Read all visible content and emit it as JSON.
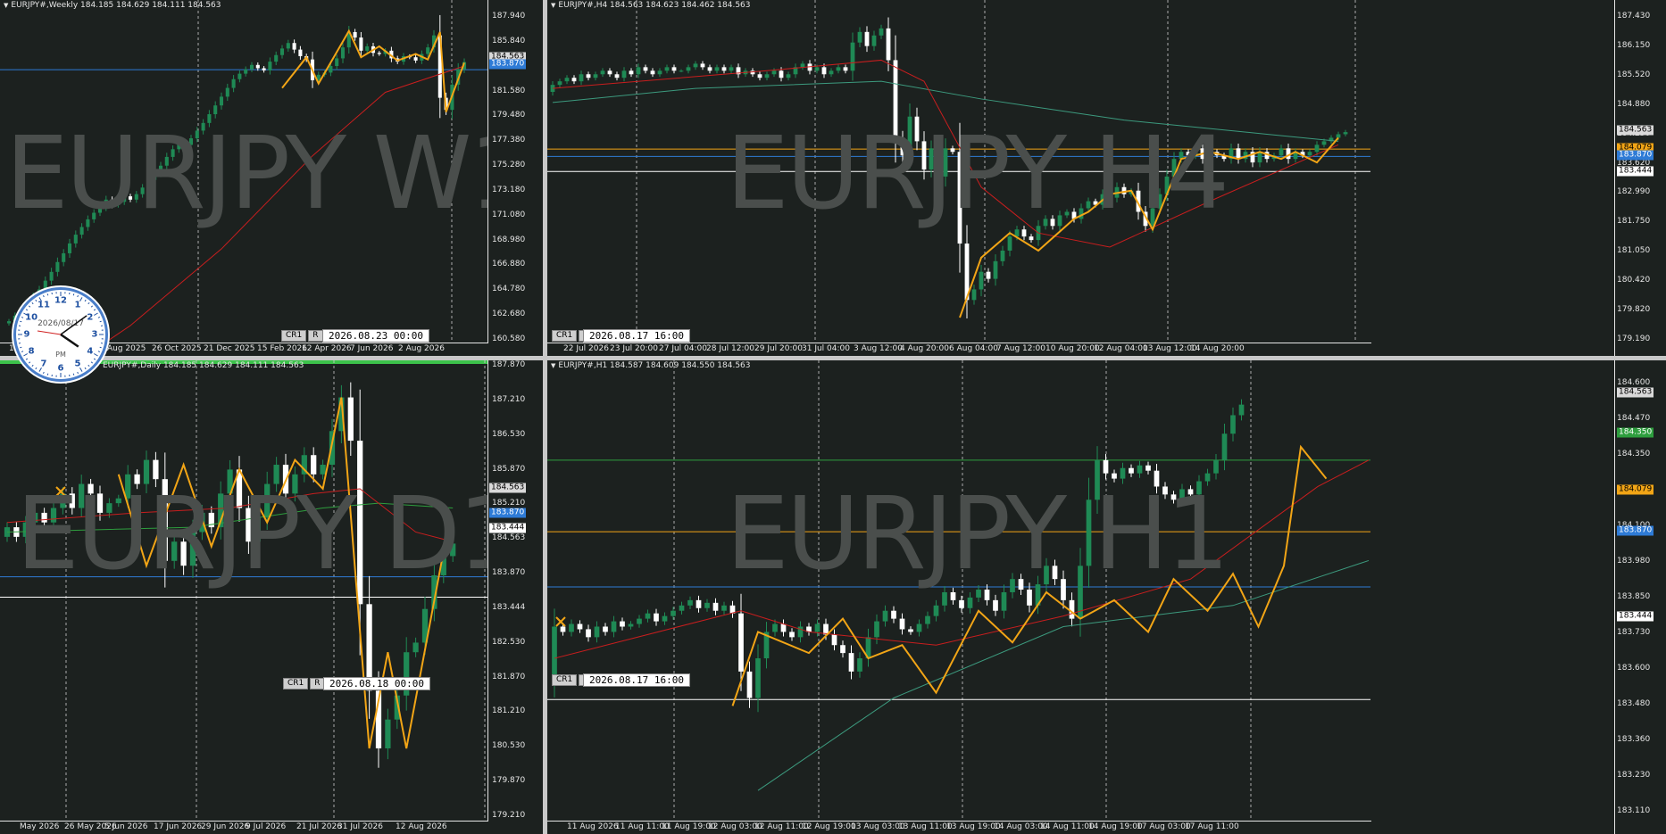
{
  "colors": {
    "bg": "#1c211f",
    "bull": "#1f8a55",
    "bear": "#ffffff",
    "zig": "#f2a516",
    "ma_red": "#c81e1e",
    "ma_teal": "#3c9a7e",
    "hl_blue": "#2e7bd6",
    "hl_orange": "#f2a516",
    "hl_white": "#ffffff",
    "hl_green": "#2e9e3e"
  },
  "panes": [
    {
      "id": "w1",
      "header": "EURJPY#,Weekly  184.185 184.629 184.111 184.563",
      "watermark": "EURJPY W1",
      "yticks": [
        "187.940",
        "185.840",
        "183.870",
        "181.580",
        "179.480",
        "177.380",
        "175.280",
        "173.180",
        "171.080",
        "168.980",
        "166.880",
        "164.780",
        "162.680",
        "160.580"
      ],
      "ytags": [
        {
          "text": "184.563",
          "bg": "#d9d9d9",
          "fg": "#000"
        },
        {
          "text": "183.870",
          "bg": "#2e7bd6",
          "fg": "#fff"
        }
      ],
      "xticks": [
        "1 May",
        "Aug 2025",
        "26 Oct 2025",
        "21 Dec 2025",
        "15 Feb 2026",
        "12 Apr 2026",
        "7 Jun 2026",
        "2 Aug 2026"
      ],
      "ctrl": [
        "CR1",
        "R"
      ],
      "date": "2026.08.23 00:00"
    },
    {
      "id": "h4",
      "header": "EURJPY#,H4  184.563 184.623 184.462 184.563",
      "watermark": "EURJPY H4",
      "yticks": [
        "187.430",
        "186.150",
        "185.520",
        "184.880",
        "184.250",
        "183.620",
        "182.990",
        "181.750",
        "181.050",
        "180.420",
        "179.820",
        "179.190"
      ],
      "ytags": [
        {
          "text": "184.563",
          "bg": "#d9d9d9",
          "fg": "#000"
        },
        {
          "text": "184.079",
          "bg": "#f2a516",
          "fg": "#000"
        },
        {
          "text": "183.870",
          "bg": "#2e7bd6",
          "fg": "#fff"
        },
        {
          "text": "183.444",
          "bg": "#ffffff",
          "fg": "#000"
        }
      ],
      "xticks": [
        "22 Jul 2026",
        "23 Jul 20:00",
        "27 Jul 04:00",
        "28 Jul 12:00",
        "29 Jul 20:00",
        "31 Jul 04:00",
        "3 Aug 12:00",
        "4 Aug 20:00",
        "6 Aug 04:00",
        "7 Aug 12:00",
        "10 Aug 20:00",
        "12 Aug 04:00",
        "13 Aug 12:00",
        "14 Aug 20:00"
      ],
      "ctrl": [
        "CR1",
        "R"
      ],
      "date": "2026.08.17 16:00"
    },
    {
      "id": "d1",
      "header": "EURJPY#,Daily  184.185 184.629 184.111 184.563",
      "watermark": "EURJPY D1",
      "yticks": [
        "187.870",
        "187.210",
        "186.530",
        "185.870",
        "185.210",
        "184.563",
        "183.870",
        "183.444",
        "182.530",
        "181.870",
        "181.210",
        "180.530",
        "179.870",
        "179.210"
      ],
      "ytags": [
        {
          "text": "184.563",
          "bg": "#d9d9d9",
          "fg": "#000"
        },
        {
          "text": "183.870",
          "bg": "#2e7bd6",
          "fg": "#fff"
        },
        {
          "text": "183.444",
          "bg": "#ffffff",
          "fg": "#000"
        }
      ],
      "xticks": [
        "May 2026",
        "26 May 2026",
        "5 Jun 2026",
        "17 Jun 2026",
        "29 Jun 2026",
        "9 Jul 2026",
        "21 Jul 2026",
        "31 Jul 2026",
        "12 Aug 2026"
      ],
      "ctrl": [
        "CR1",
        "R"
      ],
      "date": "2026.08.18 00:00"
    },
    {
      "id": "h1",
      "header": "EURJPY#,H1  184.587 184.609 184.550 184.563",
      "watermark": "EURJPY H1",
      "yticks": [
        "184.600",
        "184.470",
        "184.350",
        "184.230",
        "184.100",
        "183.980",
        "183.850",
        "183.730",
        "183.600",
        "183.480",
        "183.360",
        "183.230",
        "183.110"
      ],
      "ytags": [
        {
          "text": "184.563",
          "bg": "#d9d9d9",
          "fg": "#000"
        },
        {
          "text": "184.350",
          "bg": "#2e9e3e",
          "fg": "#fff"
        },
        {
          "text": "184.079",
          "bg": "#f2a516",
          "fg": "#000"
        },
        {
          "text": "183.870",
          "bg": "#2e7bd6",
          "fg": "#fff"
        },
        {
          "text": "183.444",
          "bg": "#ffffff",
          "fg": "#000"
        }
      ],
      "xticks": [
        "11 Aug 2026",
        "11 Aug 11:00",
        "11 Aug 19:00",
        "12 Aug 03:00",
        "12 Aug 11:00",
        "12 Aug 19:00",
        "13 Aug 03:00",
        "13 Aug 11:00",
        "13 Aug 19:00",
        "14 Aug 03:00",
        "14 Aug 11:00",
        "14 Aug 19:00",
        "17 Aug 03:00",
        "17 Aug 11:00"
      ],
      "ctrl": [
        "CR1",
        "R"
      ],
      "date": "2026.08.17 16:00"
    }
  ],
  "clock": {
    "date": "2026/08/17",
    "ampm": "PM",
    "numbers": [
      "12",
      "1",
      "2",
      "3",
      "4",
      "5",
      "6",
      "7",
      "8",
      "9",
      "10",
      "11"
    ],
    "hour": 4,
    "minute": 9
  },
  "series": {
    "w1": {
      "closes": [
        160.9,
        161.4,
        161.9,
        162.6,
        163.2,
        163.8,
        164.6,
        165.4,
        166.3,
        167.1,
        168.0,
        168.8,
        169.5,
        170.2,
        170.8,
        171.3,
        172.0,
        171.5,
        171.8,
        172.3,
        172.0,
        172.5,
        173.1,
        173.8,
        174.4,
        175.1,
        175.9,
        176.6,
        177.2,
        177.0,
        177.6,
        178.3,
        179.0,
        179.8,
        180.6,
        181.4,
        182.2,
        183.0,
        183.5,
        183.9,
        184.3,
        184.0,
        183.8,
        184.6,
        185.2,
        185.8,
        186.3,
        185.7,
        185.1,
        184.8,
        182.9,
        183.4,
        183.6,
        184.2,
        184.9,
        185.9,
        187.3,
        186.8,
        185.6,
        186.0,
        185.4,
        185.3,
        185.6,
        184.9,
        184.6,
        185.1,
        185.0,
        184.7,
        185.3,
        185.9,
        187.0,
        181.3,
        180.2,
        182.5,
        183.9,
        184.56
      ],
      "zig": [
        [
          45,
          182.2
        ],
        [
          49,
          185.0
        ],
        [
          51,
          182.6
        ],
        [
          56,
          187.4
        ],
        [
          58,
          185.0
        ],
        [
          61,
          186.0
        ],
        [
          64,
          184.7
        ],
        [
          67,
          185.3
        ],
        [
          69,
          184.8
        ],
        [
          71,
          187.3
        ],
        [
          72,
          180.0
        ],
        [
          75,
          184.5
        ]
      ],
      "ma": [
        [
          0,
          153.0
        ],
        [
          20,
          160.5
        ],
        [
          35,
          167.5
        ],
        [
          50,
          176.0
        ],
        [
          62,
          181.8
        ],
        [
          75,
          184.2
        ]
      ]
    },
    "h4": {
      "closes": [
        185.9,
        186.0,
        186.1,
        186.0,
        186.2,
        186.1,
        186.2,
        186.3,
        186.2,
        186.1,
        186.3,
        186.2,
        186.4,
        186.3,
        186.2,
        186.3,
        186.4,
        186.3,
        186.3,
        186.4,
        186.5,
        186.4,
        186.3,
        186.4,
        186.3,
        186.4,
        186.2,
        186.3,
        186.2,
        186.1,
        186.2,
        186.3,
        186.1,
        186.2,
        186.4,
        186.5,
        186.3,
        186.4,
        186.2,
        186.3,
        186.4,
        186.3,
        187.1,
        187.4,
        187.0,
        187.3,
        187.5,
        186.6,
        184.4,
        183.9,
        185.0,
        184.3,
        183.5,
        184.1,
        183.3,
        184.1,
        184.0,
        181.4,
        179.8,
        180.1,
        180.6,
        180.4,
        180.9,
        181.2,
        181.6,
        181.8,
        181.6,
        181.5,
        181.9,
        182.1,
        181.9,
        182.2,
        182.3,
        182.1,
        182.4,
        182.6,
        182.5,
        182.8,
        182.7,
        183.0,
        182.8,
        182.9,
        182.3,
        181.9,
        182.4,
        182.8,
        183.3,
        183.8,
        184.0,
        183.9,
        184.1,
        183.8,
        184.0,
        183.9,
        183.8,
        184.1,
        183.8,
        184.0,
        183.7,
        184.0,
        183.8,
        183.9,
        184.1,
        183.8,
        184.0,
        183.9,
        184.0,
        184.2,
        184.3,
        184.4,
        184.5,
        184.56
      ],
      "zig": [
        [
          57,
          179.3
        ],
        [
          60,
          181.0
        ],
        [
          64,
          181.7
        ],
        [
          68,
          181.2
        ],
        [
          73,
          182.1
        ],
        [
          75,
          182.3
        ],
        [
          78,
          182.8
        ],
        [
          81,
          182.9
        ],
        [
          84,
          181.8
        ],
        [
          88,
          183.8
        ],
        [
          92,
          184.0
        ],
        [
          96,
          183.8
        ],
        [
          99,
          184.0
        ],
        [
          102,
          183.8
        ],
        [
          104,
          184.0
        ],
        [
          107,
          183.7
        ],
        [
          110,
          184.4
        ]
      ],
      "ma_red": [
        [
          0,
          185.8
        ],
        [
          30,
          186.3
        ],
        [
          46,
          186.6
        ],
        [
          52,
          186.0
        ],
        [
          60,
          183.0
        ],
        [
          68,
          181.7
        ],
        [
          78,
          181.3
        ],
        [
          92,
          182.6
        ],
        [
          110,
          184.2
        ]
      ],
      "ma_teal": [
        [
          0,
          185.4
        ],
        [
          20,
          185.8
        ],
        [
          46,
          186.0
        ],
        [
          60,
          185.5
        ],
        [
          80,
          184.9
        ],
        [
          100,
          184.5
        ],
        [
          110,
          184.3
        ]
      ]
    },
    "d1": {
      "closes": [
        184.9,
        184.7,
        185.0,
        185.2,
        185.0,
        185.3,
        185.6,
        185.3,
        185.8,
        185.6,
        185.2,
        185.4,
        185.5,
        186.0,
        185.8,
        186.3,
        185.9,
        184.2,
        184.6,
        184.1,
        184.8,
        185.2,
        184.9,
        185.6,
        186.1,
        185.3,
        184.6,
        185.1,
        185.8,
        186.2,
        185.6,
        186.0,
        186.4,
        186.0,
        186.2,
        186.9,
        187.6,
        186.7,
        183.3,
        181.5,
        180.3,
        180.9,
        181.4,
        182.3,
        182.5,
        183.2,
        183.9,
        184.3,
        184.56
      ],
      "zig": [
        [
          12,
          186.0
        ],
        [
          15,
          184.1
        ],
        [
          19,
          186.2
        ],
        [
          22,
          184.5
        ],
        [
          25,
          186.1
        ],
        [
          28,
          185.0
        ],
        [
          31,
          186.3
        ],
        [
          34,
          185.7
        ],
        [
          36,
          187.6
        ],
        [
          39,
          180.3
        ],
        [
          41,
          182.3
        ],
        [
          43,
          180.3
        ],
        [
          47,
          184.4
        ]
      ],
      "ma_red": [
        [
          0,
          185.0
        ],
        [
          14,
          185.2
        ],
        [
          24,
          185.3
        ],
        [
          33,
          185.6
        ],
        [
          38,
          185.7
        ],
        [
          44,
          184.8
        ],
        [
          48,
          184.6
        ]
      ],
      "ma_green": [
        [
          0,
          184.8
        ],
        [
          20,
          184.9
        ],
        [
          34,
          185.3
        ],
        [
          40,
          185.4
        ],
        [
          48,
          185.3
        ]
      ]
    },
    "h1": {
      "closes": [
        183.72,
        183.7,
        183.73,
        183.71,
        183.68,
        183.72,
        183.7,
        183.74,
        183.72,
        183.73,
        183.75,
        183.77,
        183.74,
        183.76,
        183.78,
        183.8,
        183.82,
        183.79,
        183.81,
        183.78,
        183.8,
        183.77,
        183.55,
        183.45,
        183.6,
        183.7,
        183.73,
        183.7,
        183.68,
        183.72,
        183.7,
        183.73,
        183.69,
        183.65,
        183.62,
        183.55,
        183.6,
        183.68,
        183.74,
        183.78,
        183.75,
        183.71,
        183.7,
        183.73,
        183.76,
        183.8,
        183.85,
        183.82,
        183.79,
        183.83,
        183.86,
        183.82,
        183.78,
        183.85,
        183.9,
        183.86,
        183.8,
        183.88,
        183.95,
        183.9,
        183.82,
        183.75,
        183.95,
        184.2,
        184.35,
        184.3,
        184.28,
        184.32,
        184.3,
        184.33,
        184.31,
        184.25,
        184.22,
        184.2,
        184.24,
        184.22,
        184.27,
        184.3,
        184.35,
        184.45,
        184.52,
        184.56
      ],
      "zig": [
        [
          21,
          183.42
        ],
        [
          24,
          183.7
        ],
        [
          30,
          183.62
        ],
        [
          34,
          183.75
        ],
        [
          37,
          183.6
        ],
        [
          41,
          183.65
        ],
        [
          45,
          183.47
        ],
        [
          50,
          183.78
        ],
        [
          54,
          183.66
        ],
        [
          58,
          183.85
        ],
        [
          62,
          183.75
        ],
        [
          66,
          183.82
        ],
        [
          70,
          183.7
        ],
        [
          73,
          183.9
        ],
        [
          77,
          183.78
        ],
        [
          80,
          183.92
        ],
        [
          83,
          183.72
        ],
        [
          86,
          183.95
        ],
        [
          88,
          184.4
        ],
        [
          91,
          184.28
        ]
      ],
      "ma_red": [
        [
          0,
          183.6
        ],
        [
          22,
          183.78
        ],
        [
          30,
          183.7
        ],
        [
          45,
          183.65
        ],
        [
          60,
          183.76
        ],
        [
          75,
          183.9
        ],
        [
          90,
          184.25
        ],
        [
          96,
          184.35
        ]
      ],
      "ma_teal": [
        [
          24,
          183.1
        ],
        [
          40,
          183.45
        ],
        [
          60,
          183.72
        ],
        [
          80,
          183.8
        ],
        [
          96,
          183.97
        ]
      ]
    }
  }
}
